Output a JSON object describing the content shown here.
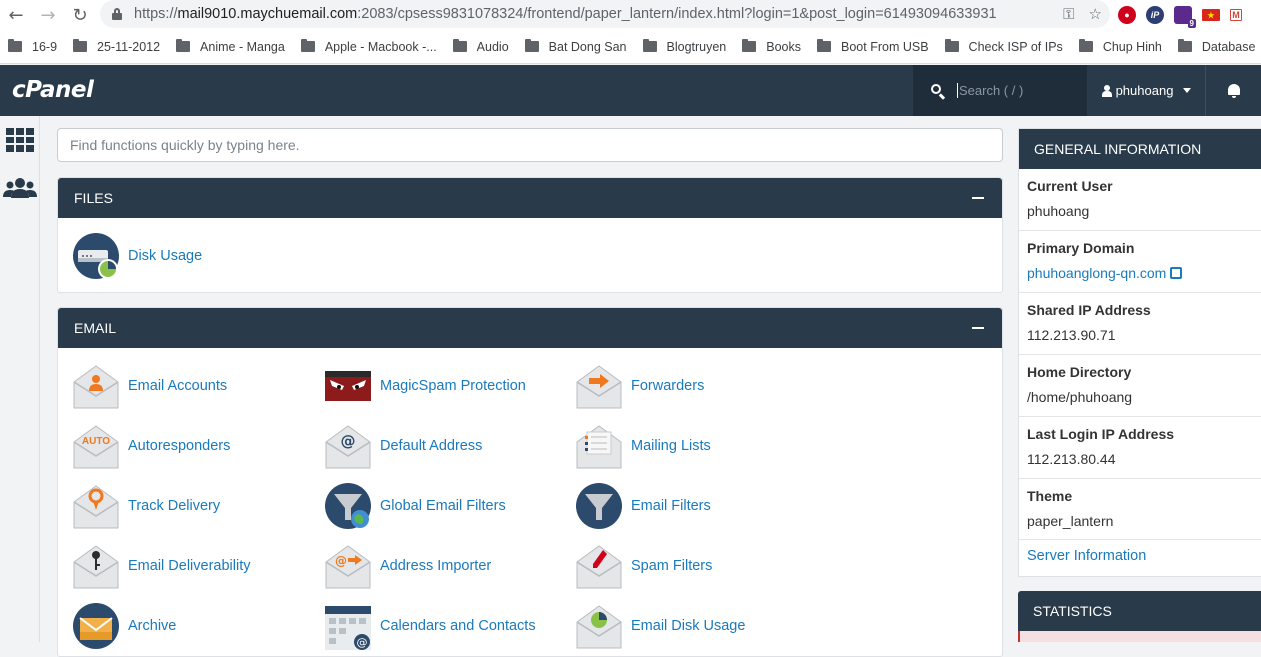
{
  "browser": {
    "url_prefix": "https://",
    "url_host": "mail9010.maychuemail.com",
    "url_rest": ":2083/cpsess9831078324/frontend/paper_lantern/index.html?login=1&post_login=61493094633931",
    "badge_count": "9"
  },
  "bookmarks": [
    "16-9",
    "25-11-2012",
    "Anime - Manga",
    "Apple - Macbook -...",
    "Audio",
    "Bat Dong San",
    "Blogtruyen",
    "Books",
    "Boot From USB",
    "Check ISP of IPs",
    "Chup Hinh",
    "Database"
  ],
  "header": {
    "logo": "cPanel",
    "search_placeholder": "Search ( / )",
    "username": "phuhoang"
  },
  "main": {
    "quick_placeholder": "Find functions quickly by typing here.",
    "files": {
      "title": "FILES",
      "items": [
        "Disk Usage"
      ]
    },
    "email": {
      "title": "EMAIL",
      "items": [
        "Email Accounts",
        "MagicSpam Protection",
        "Forwarders",
        "Autoresponders",
        "Default Address",
        "Mailing Lists",
        "Track Delivery",
        "Global Email Filters",
        "Email Filters",
        "Email Deliverability",
        "Address Importer",
        "Spam Filters",
        "Archive",
        "Calendars and Contacts",
        "Email Disk Usage"
      ],
      "auto_badge": "AUTO"
    }
  },
  "general_info": {
    "title": "GENERAL INFORMATION",
    "rows": [
      {
        "label": "Current User",
        "value": "phuhoang"
      },
      {
        "label": "Primary Domain",
        "value": "phuhoanglong-qn.com"
      },
      {
        "label": "Shared IP Address",
        "value": "112.213.90.71"
      },
      {
        "label": "Home Directory",
        "value": "/home/phuhoang"
      },
      {
        "label": "Last Login IP Address",
        "value": "112.213.80.44"
      },
      {
        "label": "Theme",
        "value": "paper_lantern"
      }
    ],
    "server_info_link": "Server Information"
  },
  "statistics": {
    "title": "STATISTICS"
  },
  "colors": {
    "header_bg": "#293a4a",
    "link": "#1a7abb",
    "accent_orange": "#f0781e"
  }
}
